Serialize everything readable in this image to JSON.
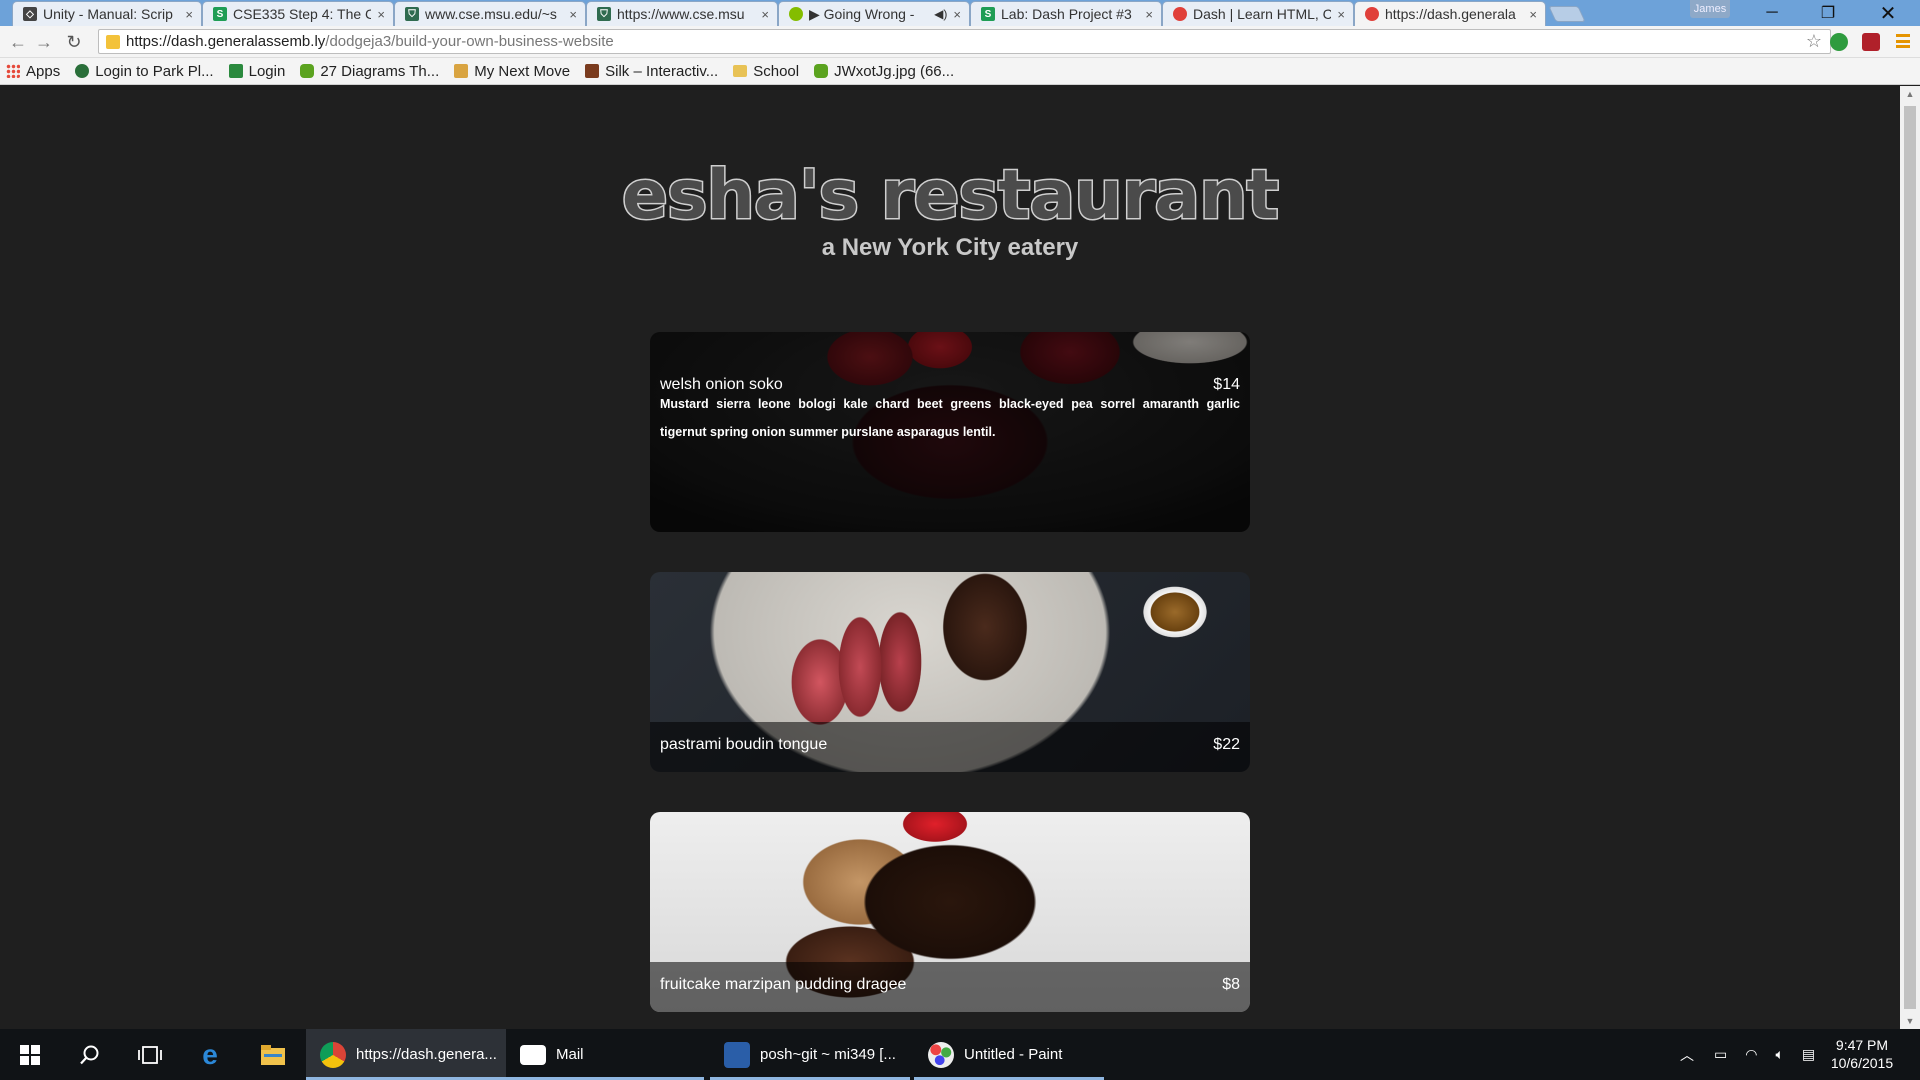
{
  "browser": {
    "tabs": [
      {
        "title": "Unity - Manual: Scrip",
        "icon": "unity-icon",
        "color": "#444444"
      },
      {
        "title": "CSE335 Step 4: The C",
        "icon": "sheets-icon",
        "color": "#1f9d55"
      },
      {
        "title": "www.cse.msu.edu/~s",
        "icon": "msu-icon",
        "color": "#2f6b4f"
      },
      {
        "title": "https://www.cse.msu",
        "icon": "msu-icon",
        "color": "#2f6b4f"
      },
      {
        "title": "▶ Going Wrong -",
        "icon": "spotify-icon",
        "color": "#84bd00"
      },
      {
        "title": "Lab: Dash Project #3",
        "icon": "sheets-icon",
        "color": "#1f9d55"
      },
      {
        "title": "Dash | Learn HTML, C",
        "icon": "dash-icon",
        "color": "#e0403a"
      },
      {
        "title": "https://dash.generala",
        "icon": "dash-icon",
        "color": "#e0403a"
      }
    ],
    "profile_name": "James",
    "close_glyph": "×",
    "url_host": "https://dash.generalassemb.ly",
    "url_path": "/dodgeja3/build-your-own-business-website",
    "bookmarks": [
      {
        "label": "Apps",
        "icon": "apps-grid-icon",
        "color": "#e5493a"
      },
      {
        "label": "Login to Park Pl...",
        "icon": "park-icon",
        "color": "#2a6f3a"
      },
      {
        "label": "Login",
        "icon": "hfs-icon",
        "color": "#2b8a3e"
      },
      {
        "label": "27 Diagrams Th...",
        "icon": "bookmark-icon",
        "color": "#5ba31f"
      },
      {
        "label": "My Next Move",
        "icon": "onet-icon",
        "color": "#d9a441"
      },
      {
        "label": "Silk – Interactiv...",
        "icon": "silk-icon",
        "color": "#7a3b1e"
      },
      {
        "label": "School",
        "icon": "folder-icon",
        "color": "#e8c255"
      },
      {
        "label": "JWxotJg.jpg (66...",
        "icon": "image-icon",
        "color": "#5ba31f"
      }
    ]
  },
  "page": {
    "title": "esha's restaurant",
    "subtitle": "a New York City eatery",
    "menu": [
      {
        "name": "welsh onion soko",
        "price": "$14",
        "description": "Mustard sierra leone bologi kale chard beet greens black-eyed pea sorrel amaranth garlic tigernut spring onion summer purslane asparagus lentil."
      },
      {
        "name": "pastrami boudin tongue",
        "price": "$22",
        "description": ""
      },
      {
        "name": "fruitcake marzipan pudding dragee",
        "price": "$8",
        "description": ""
      }
    ]
  },
  "taskbar": {
    "apps": [
      {
        "label": "https://dash.genera...",
        "icon": "chrome-icon",
        "active": true
      },
      {
        "label": "Mail",
        "icon": "mail-icon",
        "active": false
      },
      {
        "label": "posh~git ~ mi349 [...",
        "icon": "powershell-icon",
        "active": false
      },
      {
        "label": "Untitled - Paint",
        "icon": "paint-icon",
        "active": false
      }
    ],
    "time": "9:47 PM",
    "date": "10/6/2015"
  }
}
